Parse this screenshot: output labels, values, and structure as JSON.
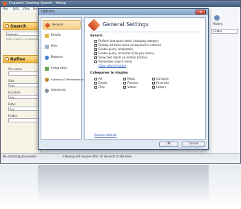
{
  "app": {
    "title": "Copernic Desktop Search - Home",
    "menu": [
      "File",
      "Edit",
      "View",
      "Help"
    ],
    "status_left": "No matching documents",
    "status_center": "Indexing will resume after 10 seconds of idle time."
  },
  "search_panel": {
    "title": "Search",
    "query_value": "batman",
    "hint": "Enter a search, or progressive",
    "refine_title": "Refine",
    "fields": [
      {
        "label": "File name:",
        "value": ""
      },
      {
        "label": "Size:",
        "value": "Any"
      },
      {
        "label": "Duration:",
        "value": "Any"
      },
      {
        "label": "Date:",
        "value": "Any"
      },
      {
        "label": "Folder:",
        "value": ""
      }
    ]
  },
  "right_panel": {
    "history_label": "History",
    "folder_label": "Folder"
  },
  "dialog": {
    "title": "Options",
    "close_symbol": "x",
    "nav": [
      {
        "label": "General",
        "icon": "general-icon",
        "color": "#d9572a",
        "selected": true
      },
      {
        "label": "Emails",
        "icon": "envelope-icon",
        "color": "#e4b847",
        "selected": false
      },
      {
        "label": "Files",
        "icon": "file-icon",
        "color": "#9bb0c8",
        "selected": false
      },
      {
        "label": "Browser",
        "icon": "globe-icon",
        "color": "#3b82c6",
        "selected": false
      },
      {
        "label": "Integration",
        "icon": "puzzle-icon",
        "color": "#6aa84f",
        "selected": false
      },
      {
        "label": "Indexing & Performance",
        "icon": "gauge-icon",
        "color": "#c28b2c",
        "selected": false
      },
      {
        "label": "Advanced",
        "icon": "gear-icon",
        "color": "#8a8f99",
        "selected": false
      }
    ],
    "content_title": "General Settings",
    "search_section": "Search",
    "search_options": [
      "Perform last query when changing category",
      "Display all items when no keyword is entered",
      "Enable query completion",
      "Enable query correction (Did you mean)",
      "Show text labels on toolbar buttons",
      "Remember search terms"
    ],
    "clear_history": "Clear search history",
    "categories_section": "Categories to display",
    "categories": [
      [
        "All",
        "Music",
        "Contacts"
      ],
      [
        "Emails",
        "Pictures",
        "Favorites"
      ],
      [
        "Files",
        "Videos",
        "History"
      ]
    ],
    "restore_defaults": "Restore defaults",
    "ok_label": "OK",
    "cancel_label": "Cancel"
  },
  "watermark": "WEB.RU"
}
